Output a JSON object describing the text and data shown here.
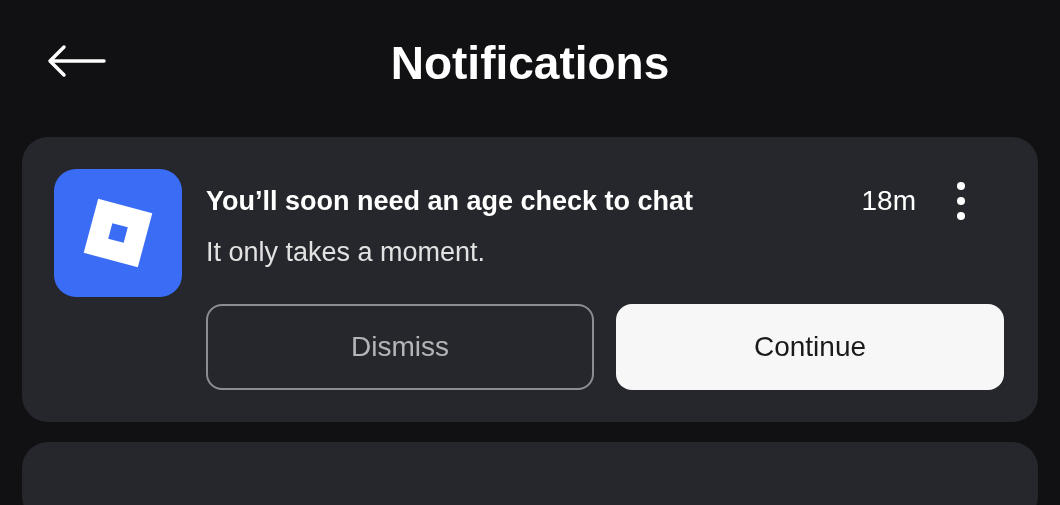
{
  "header": {
    "title": "Notifications"
  },
  "notifications": [
    {
      "title": "You’ll soon need an age check to chat",
      "time": "18m",
      "message": "It only takes a moment.",
      "buttons": [
        {
          "label": "Dismiss",
          "kind": "secondary"
        },
        {
          "label": "Continue",
          "kind": "primary"
        }
      ]
    }
  ]
}
